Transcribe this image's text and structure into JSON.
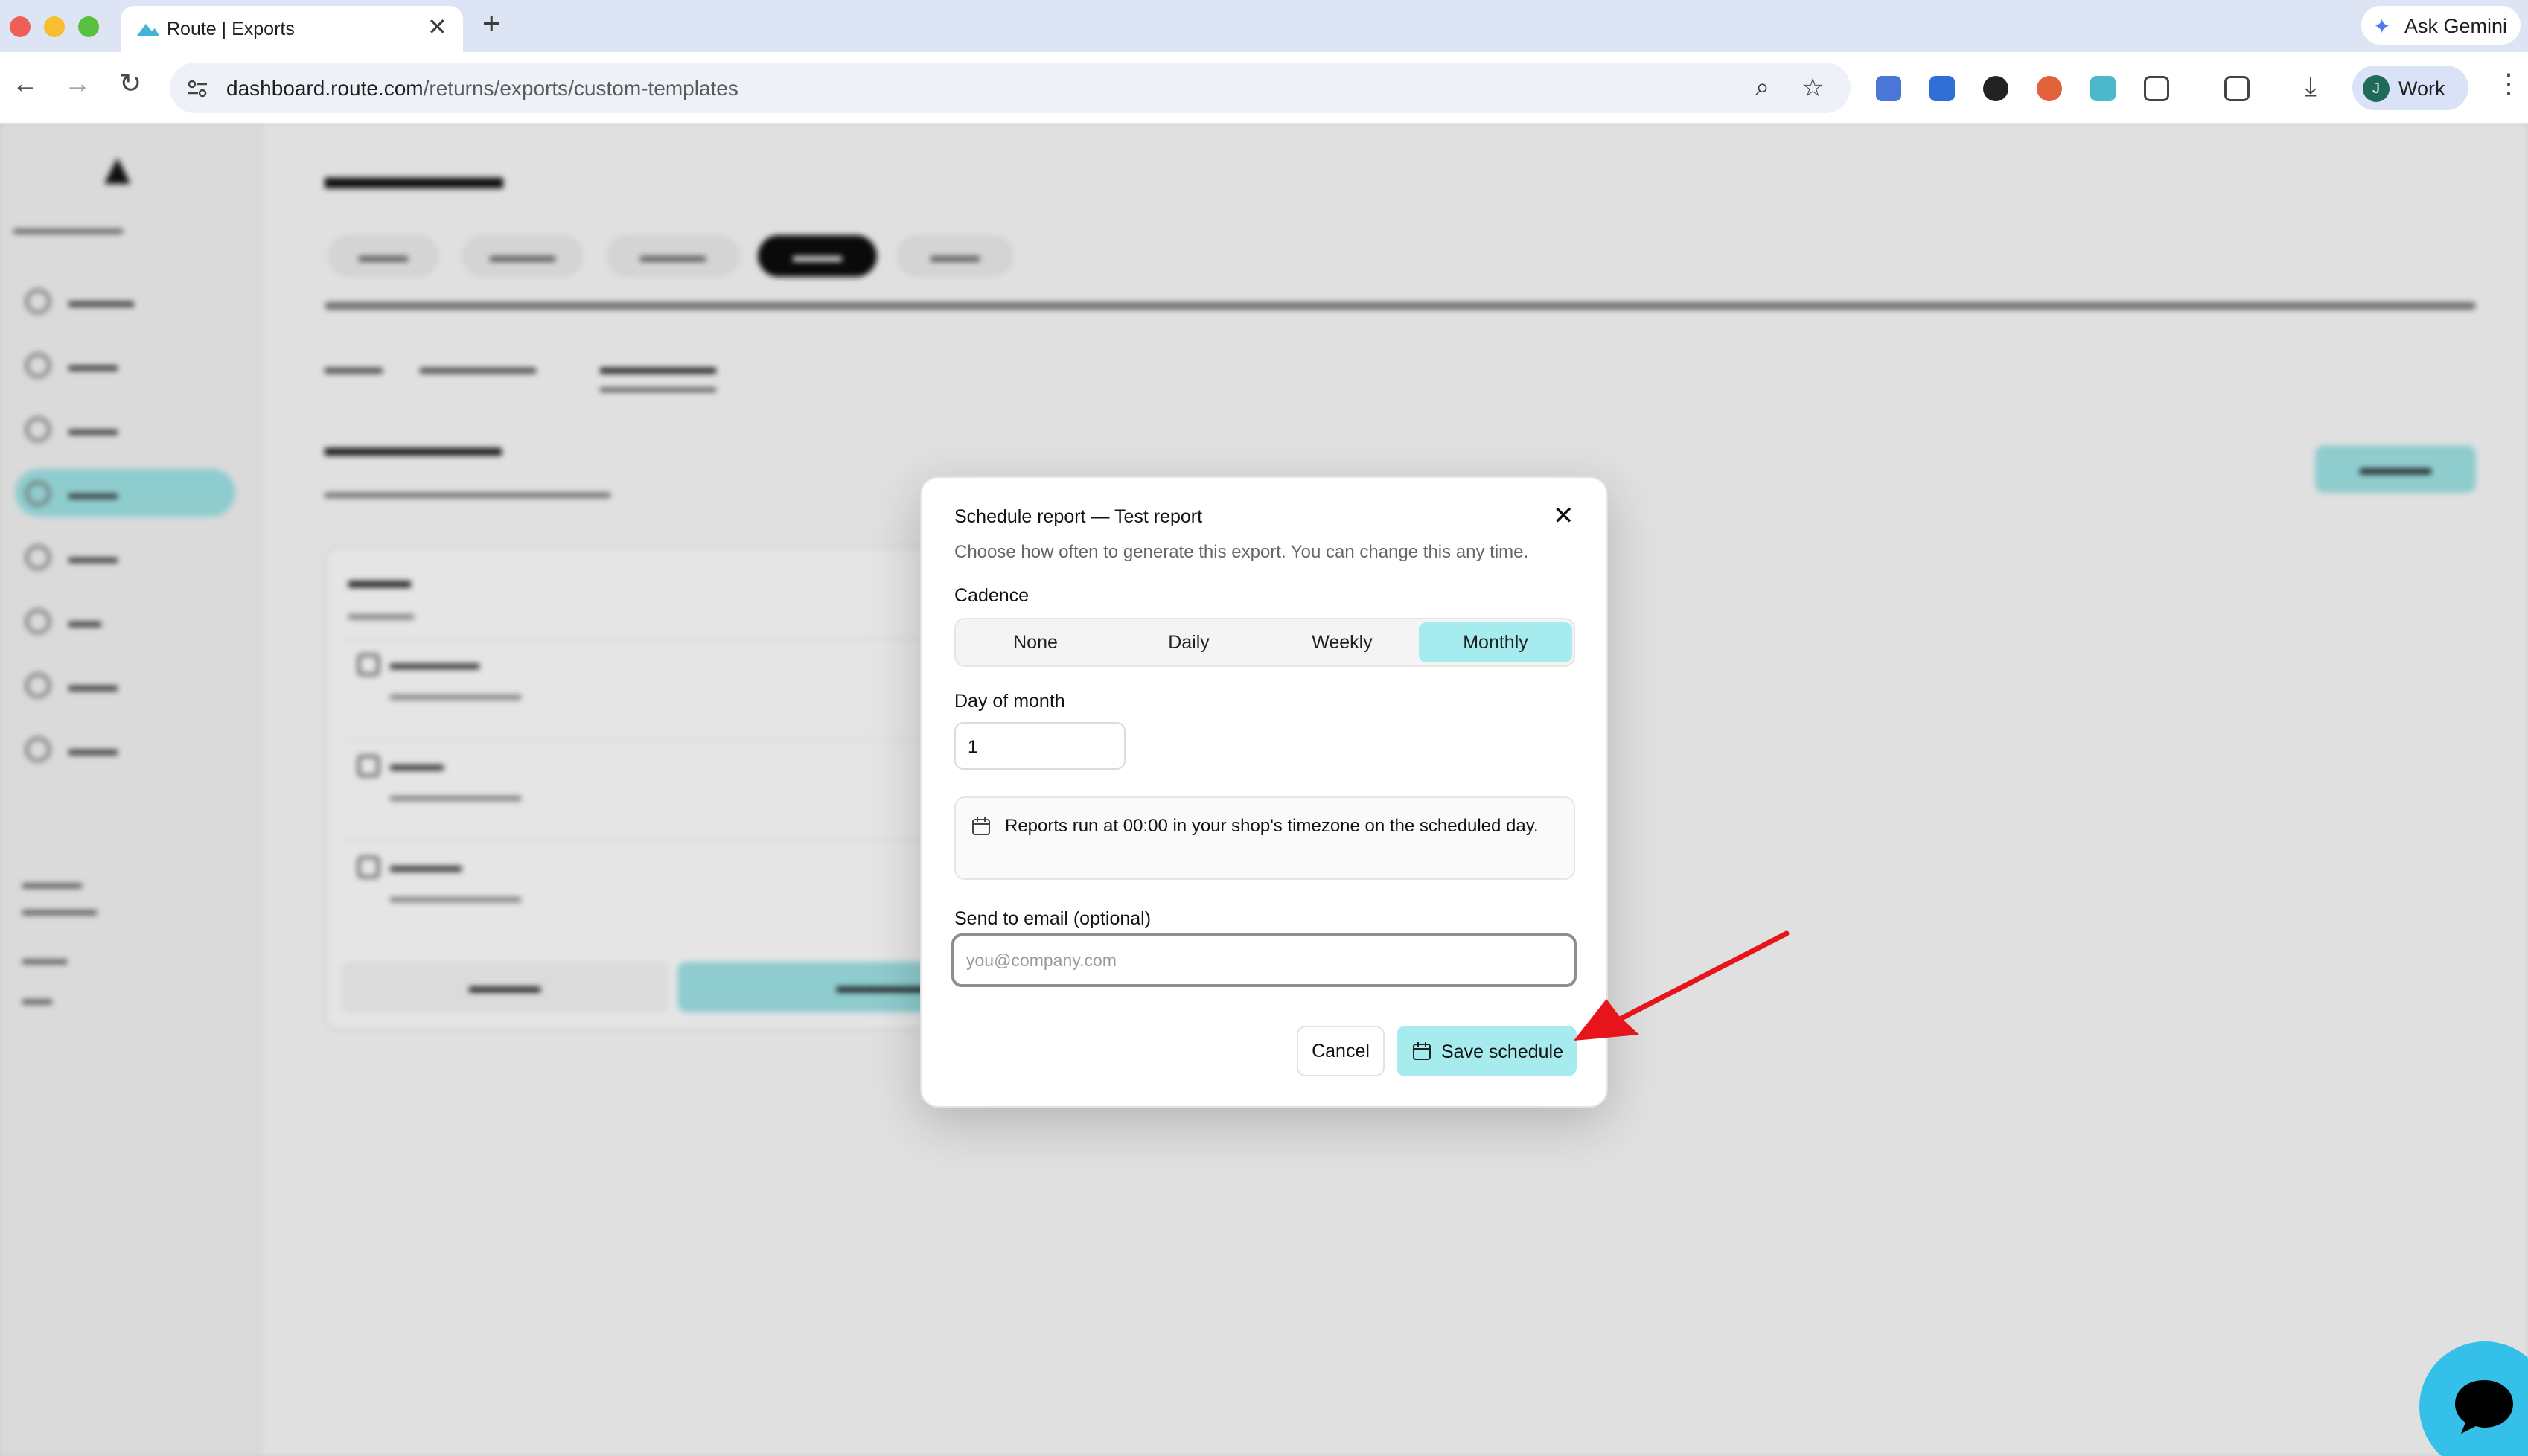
{
  "browser": {
    "tab_title": "Route | Exports",
    "url_host": "dashboard.route.com",
    "url_path": "/returns/exports/custom-templates",
    "gemini_label": "Ask Gemini",
    "profile_initial": "J",
    "profile_label": "Work",
    "icons": [
      "back-icon",
      "forward-icon",
      "reload-icon",
      "zoom-icon",
      "star-icon",
      "extensions-icon",
      "downloads-icon",
      "menu-icon"
    ]
  },
  "modal": {
    "title": "Schedule report — Test report",
    "description": "Choose how often to generate this export. You can change this any time.",
    "cadence_label": "Cadence",
    "cadence_options": [
      "None",
      "Daily",
      "Weekly",
      "Monthly"
    ],
    "cadence_selected": "Monthly",
    "day_label": "Day of month",
    "day_value": "1",
    "info_prefix": "Reports run at ",
    "info_bold": "00:00 in your shop's timezone",
    "info_suffix": " on the scheduled day.",
    "email_label": "Send to email (optional)",
    "email_placeholder": "you@company.com",
    "email_value": "",
    "cancel_label": "Cancel",
    "save_label": "Save schedule"
  },
  "colors": {
    "accent": "#a6ebee",
    "arrow": "#e8141b",
    "chat": "#35c0e9"
  }
}
